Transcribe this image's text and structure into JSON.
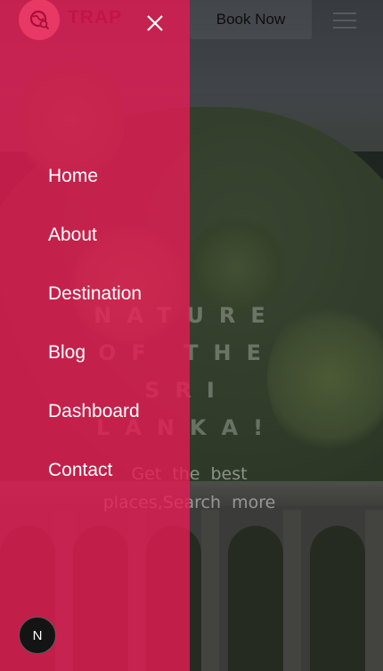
{
  "header": {
    "brand": "TRAP",
    "book_label": "Book Now",
    "logo_icon": "travel-globe-icon",
    "menu_icon": "hamburger-icon",
    "close_icon": "close-icon"
  },
  "hero": {
    "title_lines": [
      "NATURE",
      "OF THE",
      "SRI",
      "LANKA!"
    ],
    "subtitle": "Get the best places,Search more"
  },
  "nav": {
    "items": [
      "Home",
      "About",
      "Destination",
      "Blog",
      "Dashboard",
      "Contact"
    ]
  },
  "badge": {
    "label": "N"
  },
  "colors": {
    "accent": "#e81c55",
    "brand_text": "#c41446"
  }
}
